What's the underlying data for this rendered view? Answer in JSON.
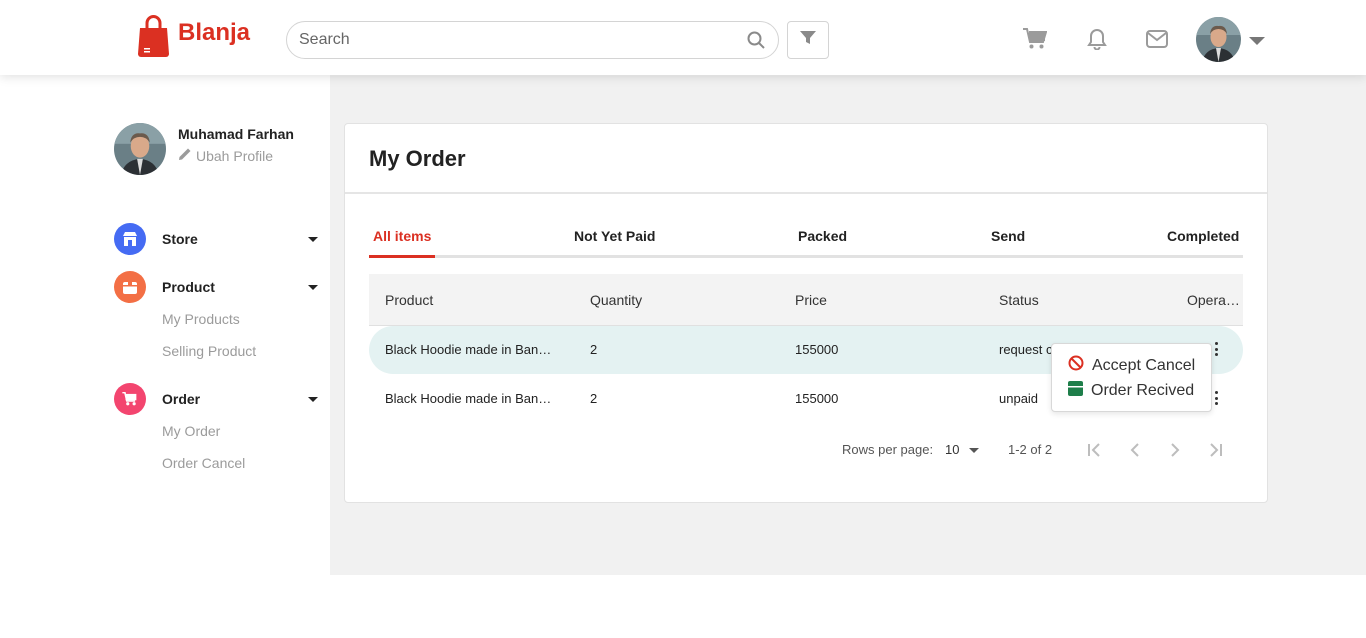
{
  "app": {
    "name": "Blanja"
  },
  "header": {
    "search_placeholder": "Search",
    "icons": [
      "search-icon",
      "filter-icon",
      "cart-icon",
      "bell-icon",
      "mail-icon",
      "chevron-down-icon"
    ]
  },
  "profile": {
    "name": "Muhamad Farhan",
    "edit_label": "Ubah Profile"
  },
  "sidebar": {
    "groups": [
      {
        "label": "Store",
        "color": "#456bf3",
        "icon": "store-icon",
        "items": []
      },
      {
        "label": "Product",
        "color": "#f36f45",
        "icon": "package-icon",
        "items": [
          "My Products",
          "Selling Product"
        ]
      },
      {
        "label": "Order",
        "color": "#f3456f",
        "icon": "cart-icon",
        "items": [
          "My Order",
          "Order Cancel"
        ]
      }
    ]
  },
  "main": {
    "title": "My Order",
    "tabs": [
      "All items",
      "Not Yet Paid",
      "Packed",
      "Send",
      "Completed"
    ],
    "active_tab": "All items",
    "table": {
      "columns": [
        "Product",
        "Quantity",
        "Price",
        "Status",
        "Opera…"
      ],
      "rows": [
        {
          "product": "Black Hoodie made in Ban…",
          "quantity": "2",
          "price": "155000",
          "status": "request c"
        },
        {
          "product": "Black Hoodie made in Ban…",
          "quantity": "2",
          "price": "155000",
          "status": "unpaid"
        }
      ]
    },
    "pagination": {
      "rows_per_page_label": "Rows per page:",
      "rows_per_page": "10",
      "range": "1-2 of 2"
    },
    "context_menu": [
      {
        "label": "Accept Cancel",
        "icon": "ban-icon",
        "color": "#db3022"
      },
      {
        "label": "Order Recived",
        "icon": "box-icon",
        "color": "#1e7e4a"
      }
    ]
  },
  "colors": {
    "brand": "#db3022",
    "highlight_row": "#e4f2f2"
  }
}
